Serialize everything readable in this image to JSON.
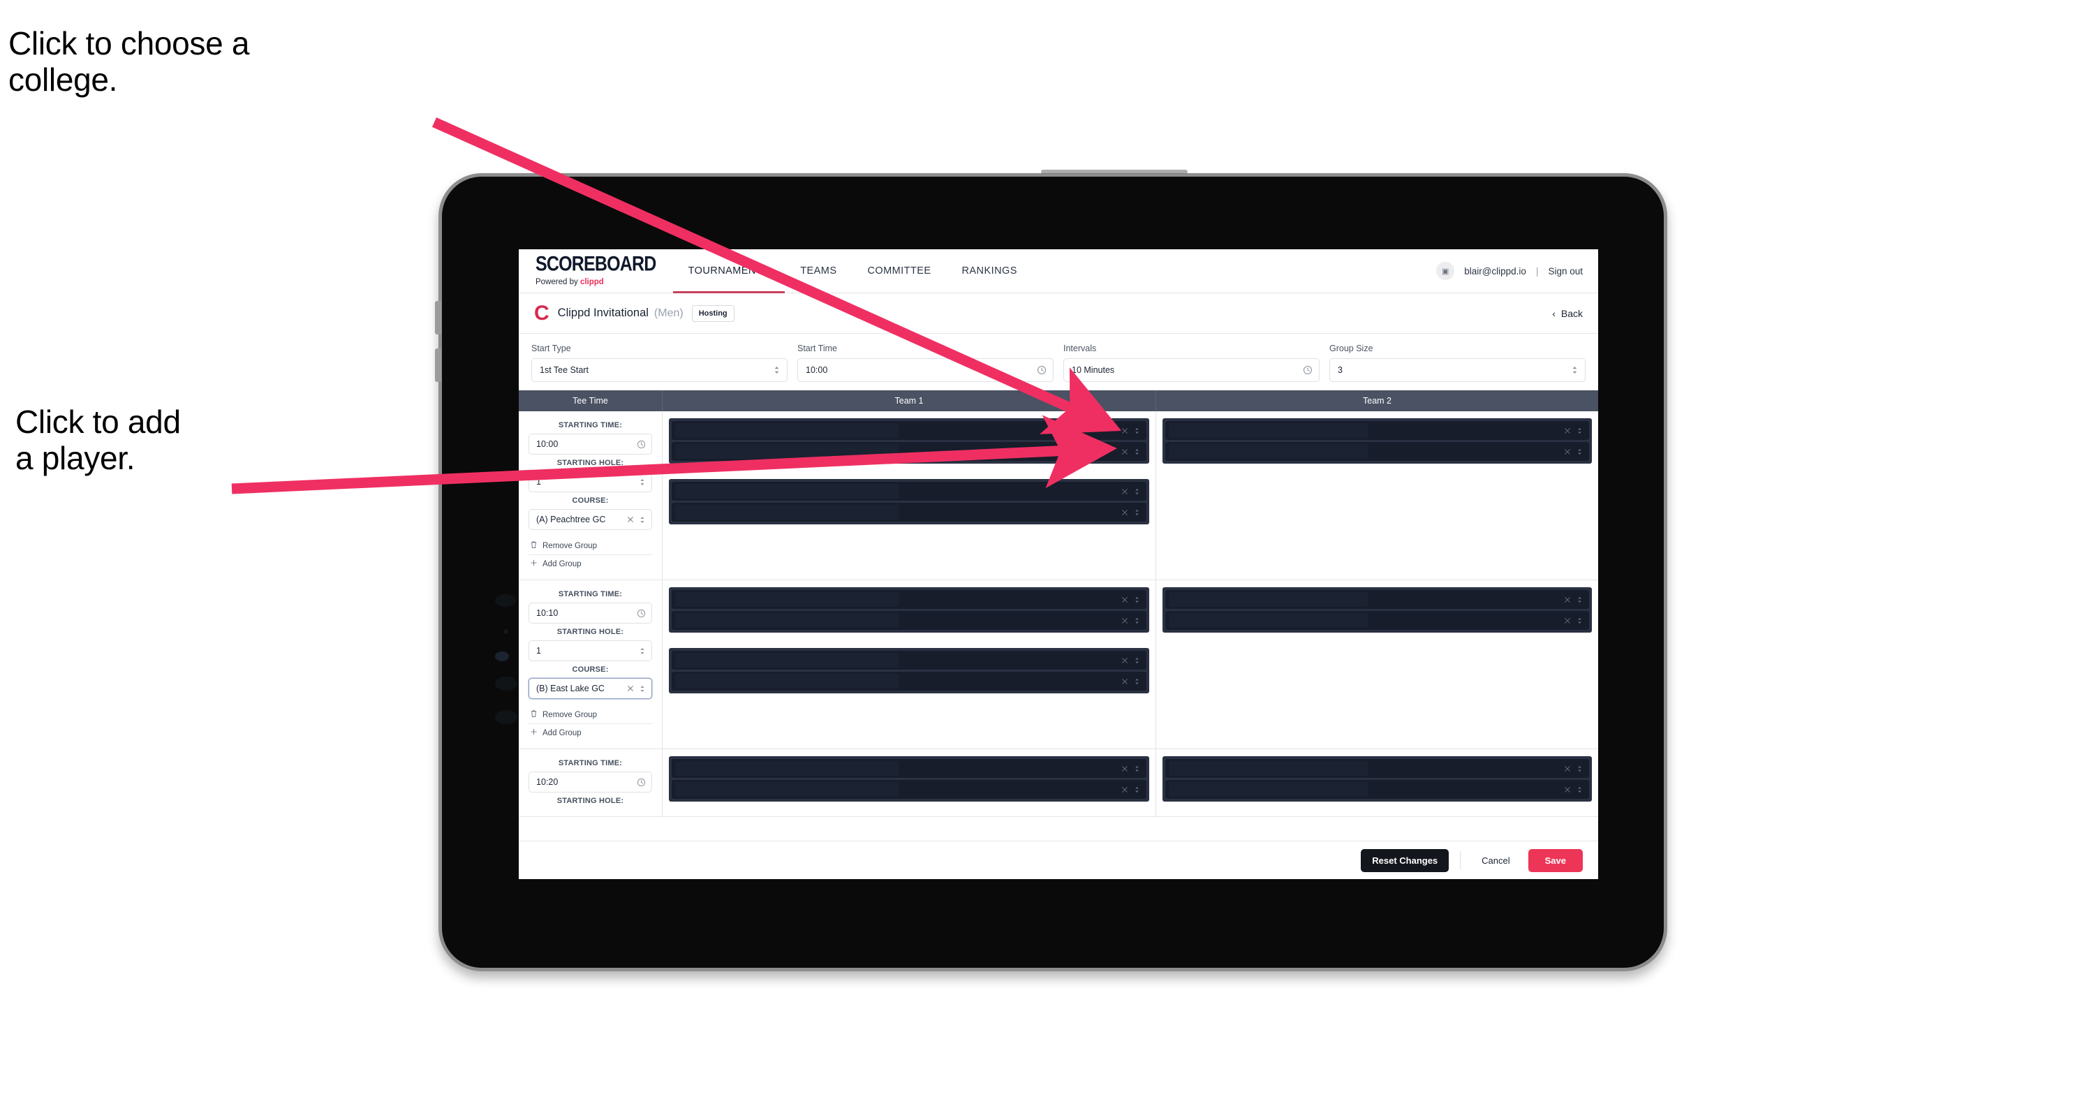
{
  "annotations": {
    "college": "Click to choose a\ncollege.",
    "player": "Click to add\na player."
  },
  "colors": {
    "accent_pink": "#ec3557",
    "arrow_pink": "#ef2f62",
    "brand_red": "#d6294f",
    "table_header": "#4a5263",
    "slot_dark": "#171d2b"
  },
  "topnav": {
    "brand_word": "SCOREBOARD",
    "brand_sub_prefix": "Powered by",
    "brand_sub_name": "clippd",
    "tabs": [
      {
        "label": "TOURNAMENTS",
        "active": true
      },
      {
        "label": "TEAMS",
        "active": false
      },
      {
        "label": "COMMITTEE",
        "active": false
      },
      {
        "label": "RANKINGS",
        "active": false
      }
    ],
    "avatar_glyph": "▣",
    "user_email": "blair@clippd.io",
    "separator": "|",
    "sign_out": "Sign out"
  },
  "tournament_header": {
    "logo_letter": "C",
    "name": "Clippd Invitational",
    "gender": "(Men)",
    "badge": "Hosting",
    "back_chevron": "‹",
    "back_label": "Back"
  },
  "controls": [
    {
      "label": "Start Type",
      "value": "1st Tee Start",
      "icon": "chevron-updown-icon"
    },
    {
      "label": "Start Time",
      "value": "10:00",
      "icon": "clock-icon"
    },
    {
      "label": "Intervals",
      "value": "10 Minutes",
      "icon": "clock-icon"
    },
    {
      "label": "Group Size",
      "value": "3",
      "icon": "chevron-updown-icon"
    }
  ],
  "table": {
    "headers": {
      "tee_time": "Tee Time",
      "team1": "Team 1",
      "team2": "Team 2"
    },
    "labels": {
      "starting_time": "STARTING TIME:",
      "starting_hole": "STARTING HOLE:",
      "course": "COURSE:",
      "remove_group": "Remove Group",
      "add_group": "Add Group"
    },
    "rows": [
      {
        "starting_time": "10:00",
        "starting_hole": "1",
        "course": "(A) Peachtree GC",
        "course_focused": false,
        "team1_groups": [
          {
            "slots": [
              "",
              ""
            ]
          },
          {
            "slots": [
              "",
              ""
            ]
          }
        ],
        "team2_groups": [
          {
            "slots": [
              "",
              ""
            ]
          }
        ]
      },
      {
        "starting_time": "10:10",
        "starting_hole": "1",
        "course": "(B) East Lake GC",
        "course_focused": true,
        "team1_groups": [
          {
            "slots": [
              "",
              ""
            ]
          },
          {
            "slots": [
              "",
              ""
            ]
          }
        ],
        "team2_groups": [
          {
            "slots": [
              "",
              ""
            ]
          }
        ]
      },
      {
        "starting_time": "10:20",
        "starting_hole": "",
        "course": "",
        "course_focused": false,
        "team1_groups": [
          {
            "slots": [
              "",
              ""
            ]
          }
        ],
        "team2_groups": [
          {
            "slots": [
              "",
              ""
            ]
          }
        ]
      }
    ]
  },
  "footer": {
    "reset": "Reset Changes",
    "cancel": "Cancel",
    "save": "Save"
  }
}
